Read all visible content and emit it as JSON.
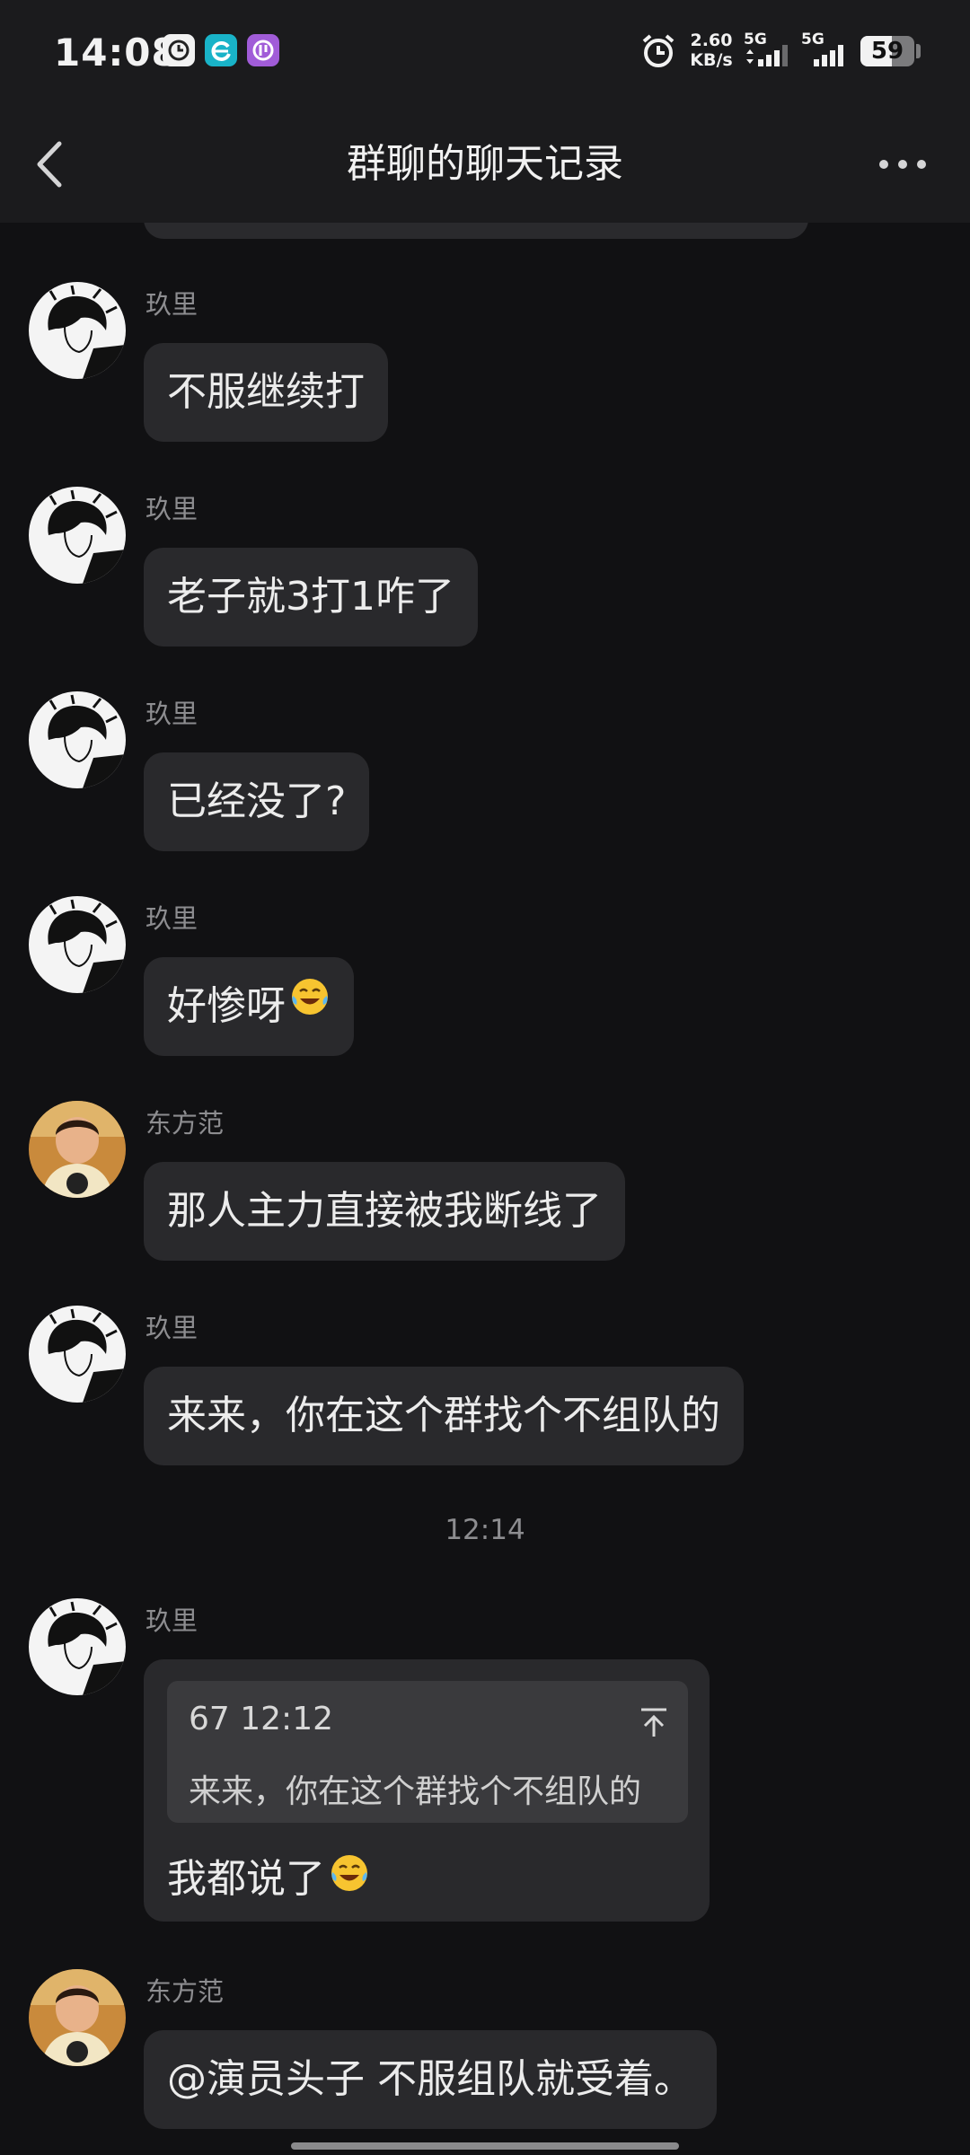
{
  "status_bar": {
    "time": "14:08",
    "net_speed_value": "2.60",
    "net_speed_unit": "KB/s",
    "signal1_label": "5G",
    "signal2_label": "5G",
    "battery_level": "59",
    "battery_fraction": 0.59
  },
  "header": {
    "title": "群聊的聊天记录"
  },
  "messages": [
    {
      "sender": "玖里",
      "text": "不服继续打",
      "avatar": "monochrome-portrait"
    },
    {
      "sender": "玖里",
      "text": "老子就3打1咋了",
      "avatar": "monochrome-portrait"
    },
    {
      "sender": "玖里",
      "text": "已经没了?",
      "avatar": "monochrome-portrait"
    },
    {
      "sender": "玖里",
      "text": "好惨呀",
      "emoji": "tears-of-joy-emoji",
      "avatar": "monochrome-portrait"
    },
    {
      "sender": "东方范",
      "text": "那人主力直接被我断线了",
      "avatar": "photo-portrait"
    },
    {
      "sender": "玖里",
      "text": "来来，你在这个群找个不组队的",
      "avatar": "monochrome-portrait"
    }
  ],
  "timestamp": "12:14",
  "quoted_message": {
    "sender": "玖里",
    "quote_meta": "67 12:12",
    "quote_text": "来来，你在这个群找个不组队的",
    "reply_text": "我都说了",
    "emoji": "tears-of-joy-emoji"
  },
  "last_message": {
    "sender": "东方范",
    "text": "@演员头子 不服组队就受着。"
  }
}
